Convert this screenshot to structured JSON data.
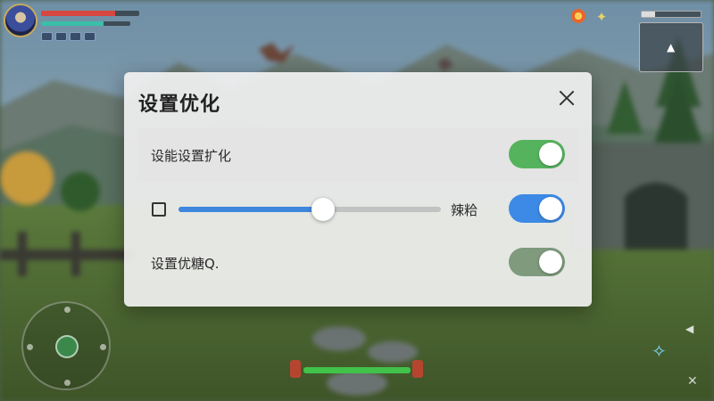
{
  "dialog": {
    "title": "设置优化",
    "rows": [
      {
        "label": "设能设置扩化",
        "toggle_on": true,
        "toggle_color": "#55b35e"
      },
      {
        "slider_label": "辣粭",
        "slider_value": 0.55,
        "checkbox_checked": false,
        "toggle_on": true,
        "toggle_color": "#3c8ae6"
      },
      {
        "label": "设置优糖Q.",
        "toggle_on": true,
        "toggle_color": "#7f9a7d"
      }
    ]
  },
  "hud": {
    "health_fraction": 0.75,
    "mana_fraction": 0.7,
    "top_right_bar_fraction": 0.22,
    "stamina_fraction": 1.0,
    "icons": [
      "player-portrait",
      "sun-icon",
      "quest-star-icon",
      "minimap",
      "joystick",
      "crystal-icon",
      "close-icon",
      "arrow-left-icon"
    ]
  }
}
